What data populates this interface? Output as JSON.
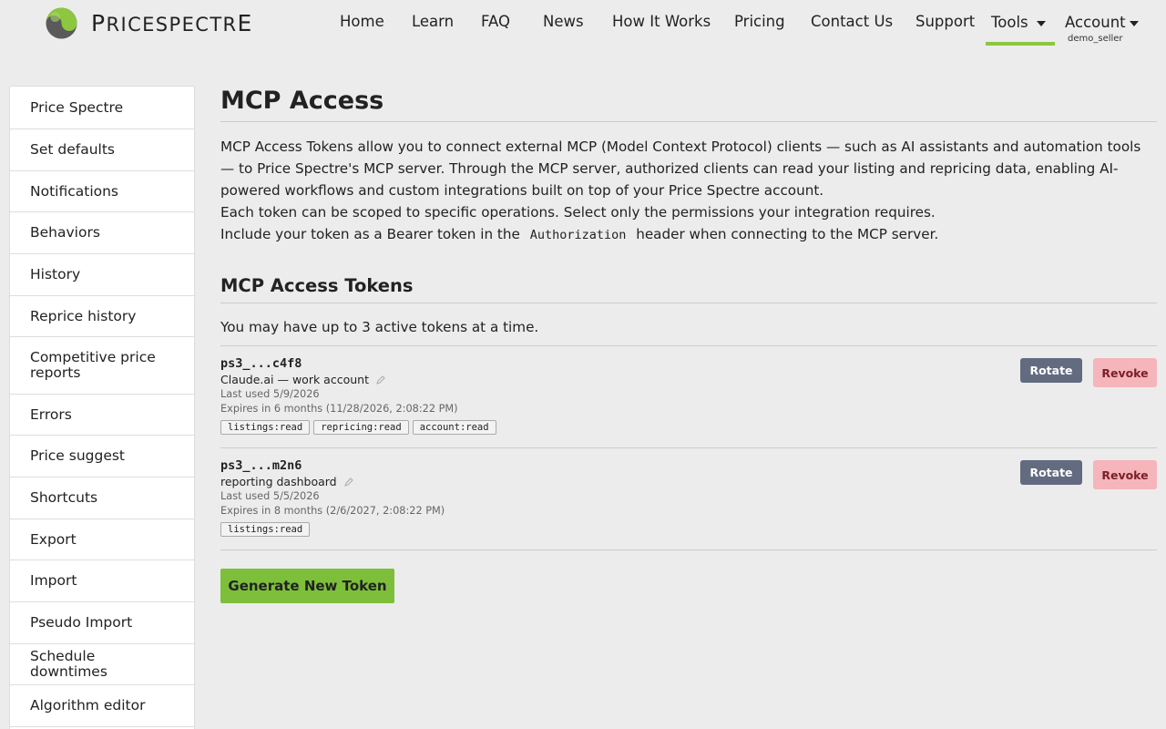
{
  "brand": {
    "name": "PRICESPECTRE",
    "first_letter": "P",
    "rest": "RICESPECTR",
    "last_letter": "E",
    "logo_icon": "yin-yang-logo-icon",
    "accent": "#8dc63f"
  },
  "nav": {
    "items": [
      "Home",
      "Learn",
      "FAQ",
      "News",
      "How It Works",
      "Pricing",
      "Contact Us",
      "Support"
    ],
    "tools": "Tools",
    "account": "Account",
    "account_user": "demo_seller"
  },
  "sidebar": {
    "items": [
      "Price Spectre",
      "Set defaults",
      "Notifications",
      "Behaviors",
      "History",
      "Reprice history",
      "Competitive price reports",
      "Errors",
      "Price suggest",
      "Shortcuts",
      "Export",
      "Import",
      "Pseudo Import",
      "Schedule downtimes",
      "Algorithm editor"
    ]
  },
  "main": {
    "title": "MCP Access",
    "desc_p1": "MCP Access Tokens allow you to connect external MCP (Model Context Protocol) clients — such as AI assistants and automation tools — to Price Spectre's MCP server. Through the MCP server, authorized clients can read your listing and repricing data, enabling AI-powered workflows and custom integrations built on top of your Price Spectre account.",
    "desc_p2": "Each token can be scoped to specific operations. Select only the permissions your integration requires.",
    "desc_p3_a": "Include your token as a Bearer token in the",
    "desc_p3_code": "Authorization",
    "desc_p3_b": "header when connecting to the MCP server.",
    "section_title": "MCP Access Tokens",
    "limit_note": "You may have up to 3 active tokens at a time.",
    "tokens": [
      {
        "id": "ps3_...c4f8",
        "name": "Claude.ai — work account",
        "last_used": "Last used 5/9/2026",
        "expires": "Expires in 6 months (11/28/2026, 2:08:22 PM)",
        "scopes": [
          "listings:read",
          "repricing:read",
          "account:read"
        ]
      },
      {
        "id": "ps3_...m2n6",
        "name": "reporting dashboard",
        "last_used": "Last used 5/5/2026",
        "expires": "Expires in 8 months (2/6/2027, 2:08:22 PM)",
        "scopes": [
          "listings:read"
        ]
      }
    ],
    "rotate_label": "Rotate",
    "revoke_label": "Revoke",
    "generate_label": "Generate New Token"
  },
  "colors": {
    "rotate_bg": "#636b80",
    "revoke_bg": "#f5b5bb",
    "generate_bg": "#7dbf3a"
  }
}
